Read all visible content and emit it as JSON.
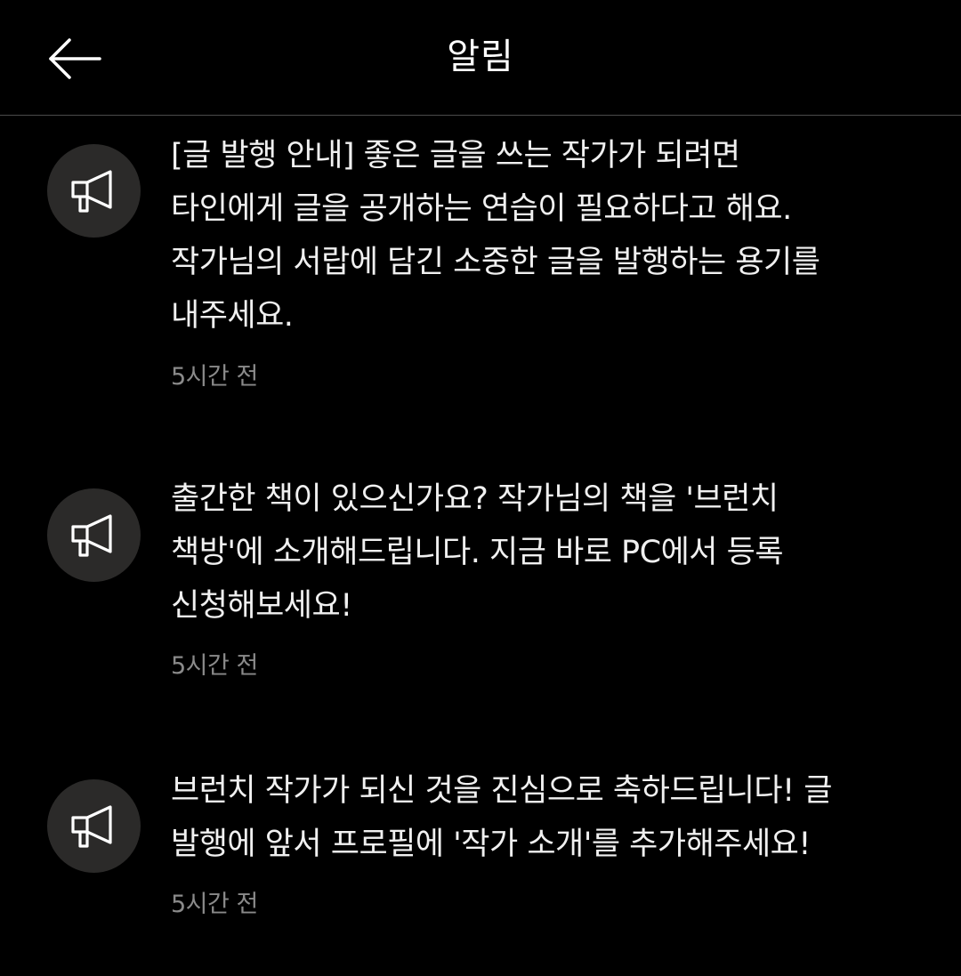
{
  "header": {
    "title": "알림",
    "back_icon": "arrow-left-icon"
  },
  "notifications": [
    {
      "icon": "megaphone-icon",
      "lines": [
        "[글 발행 안내]  좋은 글을 쓰는 작가가 되려면",
        "타인에게 글을 공개하는 연습이 필요하다고 해요.",
        "작가님의 서랍에 담긴 소중한 글을 발행하는 용기를",
        "내주세요."
      ],
      "time": "5시간 전"
    },
    {
      "icon": "megaphone-icon",
      "lines": [
        "출간한 책이 있으신가요?  작가님의 책을 '브런치",
        "책방'에 소개해드립니다. 지금 바로 PC에서 등록",
        "신청해보세요!"
      ],
      "time": "5시간 전"
    },
    {
      "icon": "megaphone-icon",
      "lines": [
        "브런치 작가가 되신 것을 진심으로 축하드립니다!  글",
        "발행에 앞서 프로필에 '작가 소개'를 추가해주세요!"
      ],
      "time": "5시간 전"
    }
  ],
  "colors": {
    "background": "#000000",
    "avatar_bg": "#2b2a29",
    "text": "#f0f0f0",
    "time_text": "#8a8a8a",
    "divider": "#4a4a4a"
  }
}
